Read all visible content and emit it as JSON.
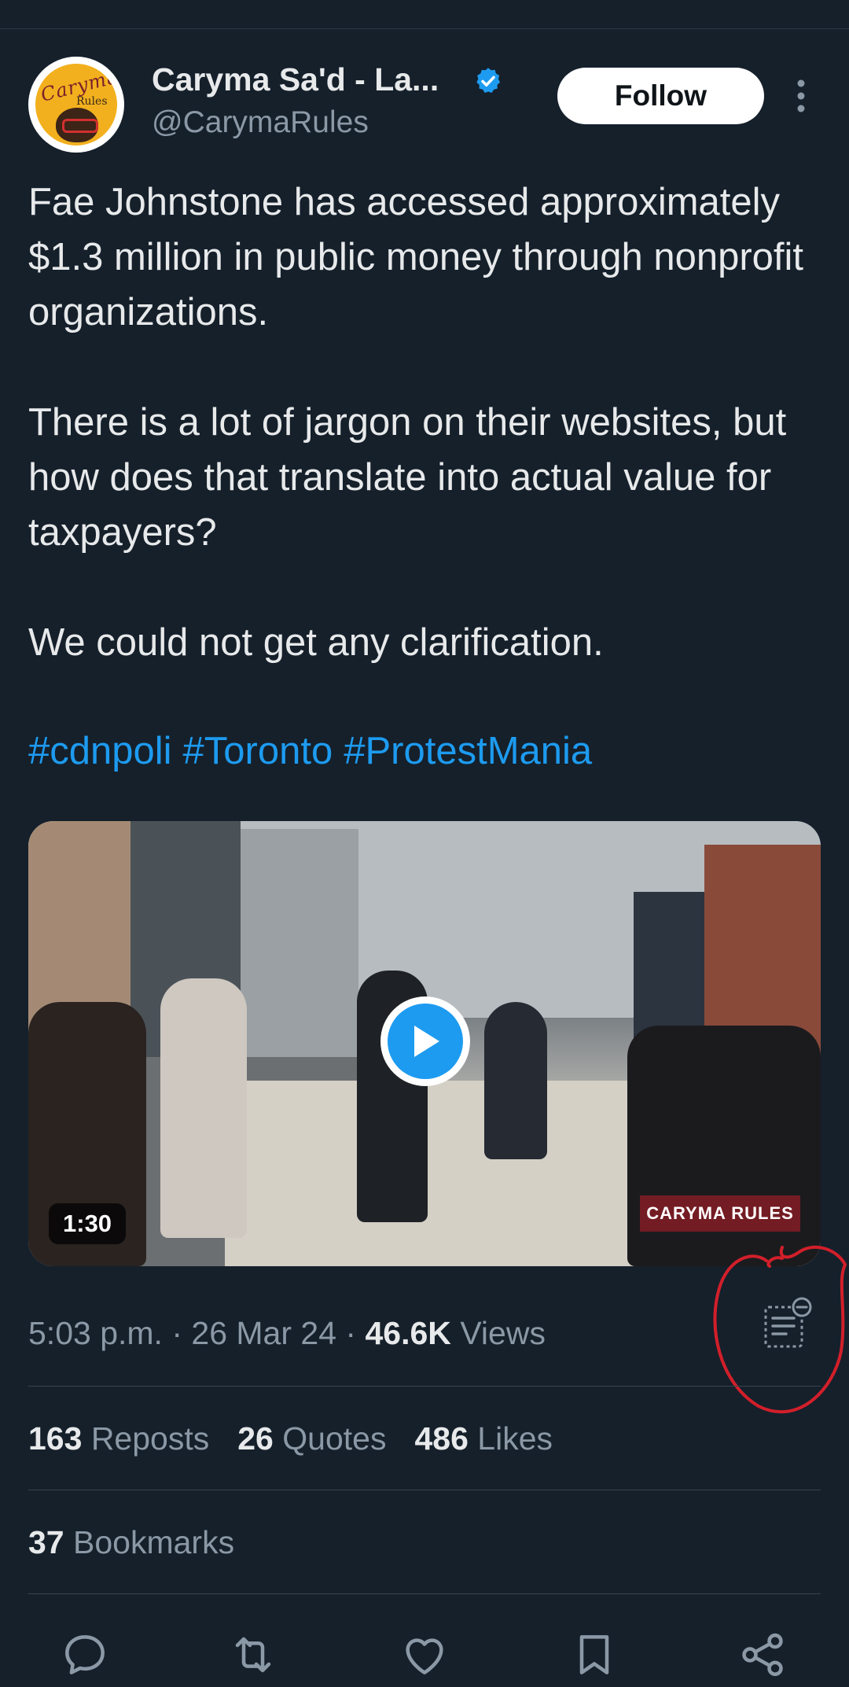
{
  "author": {
    "name": "Caryma Sa'd - La...",
    "handle": "@CarymaRules",
    "verified": true,
    "avatar_text": "Caryma",
    "avatar_sub": "Rules"
  },
  "follow_label": "Follow",
  "tweet": {
    "paragraph1": "Fae Johnstone has accessed approximately $1.3 million in public money through nonprofit organizations.",
    "paragraph2": "There is a lot of jargon on their websites, but how does that translate into actual value for taxpayers?",
    "paragraph3": "We could not get any clarification.",
    "hashtags": [
      "#cdnpoli",
      "#Toronto",
      "#ProtestMania"
    ]
  },
  "media": {
    "duration": "1:30",
    "watermark": "CARYMA RULES"
  },
  "meta": {
    "time": "5:03 p.m.",
    "date": "26 Mar 24",
    "separator": "·",
    "views_count": "46.6K",
    "views_label": "Views"
  },
  "stats": {
    "reposts_count": "163",
    "reposts_label": "Reposts",
    "quotes_count": "26",
    "quotes_label": "Quotes",
    "likes_count": "486",
    "likes_label": "Likes",
    "bookmarks_count": "37",
    "bookmarks_label": "Bookmarks"
  },
  "colors": {
    "background": "#15202b",
    "accent": "#1d9bf0",
    "annotation": "#d21f2a"
  },
  "icons": [
    "verified-badge-icon",
    "more-options-icon",
    "play-icon",
    "community-notes-icon",
    "reply-icon",
    "repost-icon",
    "like-icon",
    "bookmark-icon",
    "share-icon"
  ]
}
